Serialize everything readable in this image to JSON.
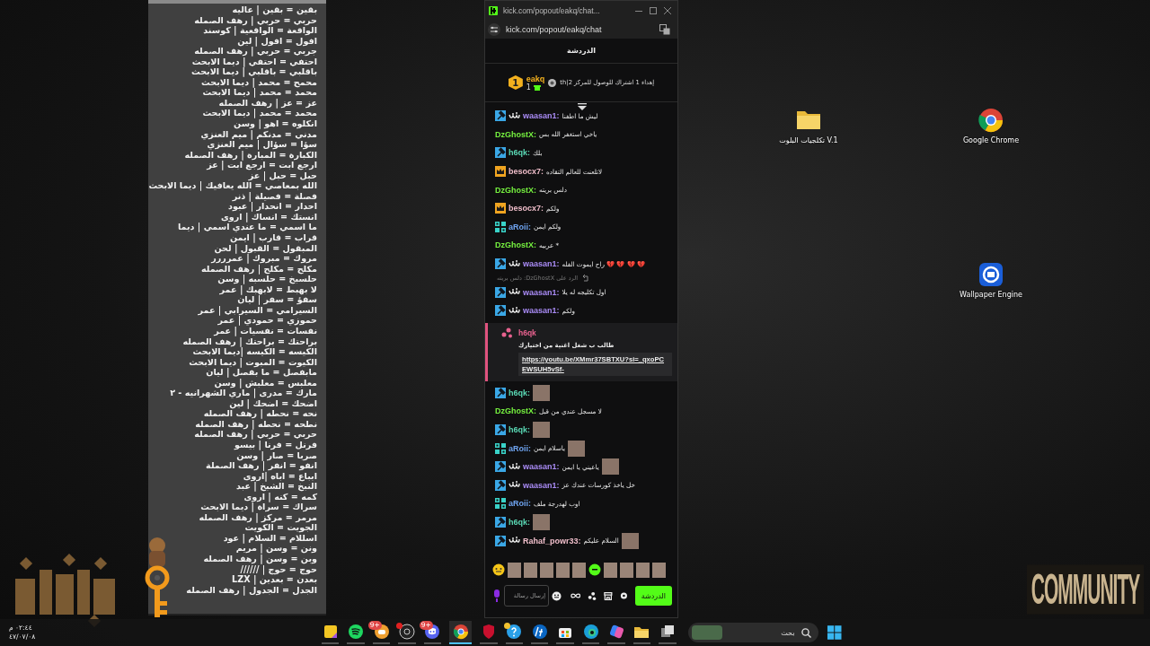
{
  "notepad": {
    "lines": [
      "بقين = بقين | عاليه",
      "حربي = حربي | رهف الصمله",
      "الواقعة = الواقعية | كوسند",
      "افول = افول | لين",
      "جربي = حربي | رهف الصمله",
      "احتفي = احتفي | ديما الابحث",
      "باقلبي = باقلبي | ديما الابحث",
      "محمح = محمد | ديما الابحث",
      "محمد = محمد | ديما الابحث",
      "عز = عز | رهف الصمله",
      "محمد = محمد | ديما الابحث",
      "انكلوه = اهو | وسن",
      "مدني = مدنكم | ميم العنزي",
      "سؤا = سؤال | ميم العنزي",
      "الكبارة = المبارة | رهف الصمله",
      "ارجع ابت = ارجع ابت | عز",
      "حبل = حبل | عز",
      "الله بمعاصي = الله يعافيك | ديما الابحث",
      "فصلة = فصيلة | ذنر",
      "احدار = انحدار | عبود",
      "انستك = انساك | اروى",
      "ما اسمي = ما عندي اسمي | ديما",
      "قراب = قارب | ايمن",
      "المبقول = القبول | لحن",
      "مروك = مبروك | عمرررر",
      "مكلح = مكلح | رهف الصمله",
      "حلسبخ = حلسبه | وسن",
      "لا بهبط = لابهبك | عمر",
      "سفؤ = سفر | ليان",
      "السيرامي = السيرابي | عمر",
      "حموزي = حمودي | عمر",
      "نفسات = نفسيات | عمر",
      "براحتك = براحتك | رهف الصمله",
      "الكيسه = الكيسه |ديما الابحث",
      "الكيوت = المبوت | ديما الابحث",
      "مابفصل = ما بفصل | ليان",
      "معلبس = معلبش | وسن",
      "مارك = مدرى | ماري الشهرانيه - ٢",
      "اضحك = اضحك | لين",
      "نحه = نحطه | رهف الصمله",
      "نطحه = نحطه | رهف الصمله",
      "حربي = حربي | رهف الصمله",
      "فرنل = فرنا | بيسو",
      "صربا = صار | وسن",
      "انفو = انفر | رهف الصملة",
      "ابباع = اباه |اروى",
      "النبخ = الشبخ | عبد",
      "كمه = كنه | اروى",
      "سراك = سراة | ديما الابحث",
      "مرمر = مركز | رهف الصمله",
      "الجويت = الكويت",
      "اسللام = السلام | عود",
      "ونن = وسن | مريم",
      "وبن = وسن | رهف الصمله",
      "حوج = حوج | //////",
      "بعدن = بعدين | LZX",
      "الجدل = الجدول | رهف الصمله"
    ]
  },
  "chat_window": {
    "title": "kick.com/popout/eakq/chat...",
    "url": "kick.com/popout/eakq/chat",
    "header": "الدردشة",
    "pinned": {
      "rank": "1",
      "username": "eakq",
      "gifts": "1",
      "text": "th|إهداء 1 اشتراك للوصول للمركز 2"
    },
    "messages": [
      {
        "kind": "message",
        "badges": [
          {
            "kind": "moderator"
          },
          {
            "kind": "subscriber"
          }
        ],
        "username": "waasan1:",
        "color": "#a98bf5",
        "text": "ليش ما اطفنا"
      },
      {
        "kind": "message",
        "username": "DzGhostX:",
        "color": "#75f03f",
        "text": "ياخي استغفر الله بس"
      },
      {
        "kind": "message",
        "badges": [
          {
            "kind": "moderator"
          }
        ],
        "username": "h6qk:",
        "color": "#5ad8b4",
        "text": "بلك"
      },
      {
        "kind": "message",
        "badges": [
          {
            "kind": "crown"
          }
        ],
        "username": "besocx7:",
        "color": "#f1bfcb",
        "text": "لاتلعنت للعالم التقاده"
      },
      {
        "kind": "message",
        "username": "DzGhostX:",
        "color": "#75f03f",
        "text": "دلس بريته"
      },
      {
        "kind": "message",
        "badges": [
          {
            "kind": "crown"
          }
        ],
        "username": "besocx7:",
        "color": "#f1bfcb",
        "text": "ولكم"
      },
      {
        "kind": "message",
        "badges": [
          {
            "kind": "og"
          }
        ],
        "username": "aRoii:",
        "color": "#6fa4f0",
        "text": "ولكم ايمن"
      },
      {
        "kind": "message",
        "username": "DzGhostX:",
        "color": "#75f03f",
        "text": "* عربيه"
      },
      {
        "kind": "message",
        "badges": [
          {
            "kind": "moderator"
          },
          {
            "kind": "subscriber"
          }
        ],
        "username": "waasan1:",
        "color": "#a98bf5",
        "text": "💔 💔 💔 💔 راح ايموت الفله"
      },
      {
        "kind": "message",
        "badges": [
          {
            "kind": "moderator"
          },
          {
            "kind": "subscriber"
          }
        ],
        "username": "waasan1:",
        "color": "#a98bf5",
        "text": "اول تكليجه له يلا",
        "reply_to": "الرد على DzGhostX: دلس بريته"
      },
      {
        "kind": "message",
        "badges": [
          {
            "kind": "moderator"
          },
          {
            "kind": "subscriber"
          }
        ],
        "username": "waasan1:",
        "color": "#a98bf5",
        "text": "ولكم"
      },
      {
        "kind": "highlight",
        "username": "h6qk",
        "color": "#e8628f",
        "text": "طالب ب شغل اغنية من اختيارك",
        "link": "https://youtu.be/XMmr37SBTXU?si=_qxoPCEWSUH5vSf-"
      },
      {
        "kind": "message",
        "badges": [
          {
            "kind": "moderator"
          }
        ],
        "username": "h6qk:",
        "color": "#5ad8b4",
        "emote": true
      },
      {
        "kind": "message",
        "username": "DzGhostX:",
        "color": "#75f03f",
        "text": "لا مسجل عندي من قبل"
      },
      {
        "kind": "message",
        "badges": [
          {
            "kind": "moderator"
          }
        ],
        "username": "h6qk:",
        "color": "#5ad8b4",
        "emote": true
      },
      {
        "kind": "message",
        "badges": [
          {
            "kind": "og"
          }
        ],
        "username": "aRoii:",
        "color": "#6fa4f0",
        "text": "ياسلام ايمن",
        "emote": true
      },
      {
        "kind": "message",
        "badges": [
          {
            "kind": "moderator"
          },
          {
            "kind": "subscriber"
          }
        ],
        "username": "waasan1:",
        "color": "#a98bf5",
        "text": "ياعيني يا ايمن",
        "emote": true
      },
      {
        "kind": "message",
        "badges": [
          {
            "kind": "moderator"
          },
          {
            "kind": "subscriber"
          }
        ],
        "username": "waasan1:",
        "color": "#a98bf5",
        "text": "خل ياخذ كورسات عندك عز"
      },
      {
        "kind": "message",
        "badges": [
          {
            "kind": "og"
          }
        ],
        "username": "aRoii:",
        "color": "#6fa4f0",
        "text": "اوب لهدرجة ملف"
      },
      {
        "kind": "message",
        "badges": [
          {
            "kind": "moderator"
          }
        ],
        "username": "h6qk:",
        "color": "#5ad8b4",
        "emote": true
      },
      {
        "kind": "message",
        "badges": [
          {
            "kind": "moderator"
          },
          {
            "kind": "subscriber"
          }
        ],
        "username": "Rahaf_powr33:",
        "color": "#f1bfcb",
        "text": "السلام عليكم",
        "emote": true
      }
    ],
    "input": {
      "placeholder": "إرسال رسالة"
    },
    "send_button": "الدردشة"
  },
  "desktop_icons": [
    {
      "kind": "chrome",
      "label": "Google Chrome"
    },
    {
      "kind": "folder",
      "label": "تكلجيات البلوت V.1"
    },
    {
      "kind": "wallpaper",
      "label": "Wallpaper Engine"
    }
  ],
  "overlay": {
    "community": "COMMUNITY"
  },
  "taskbar": {
    "search_placeholder": "بحث",
    "apps": [
      {
        "kind": "taskview",
        "active": false
      },
      {
        "kind": "files",
        "active": false
      },
      {
        "kind": "copilot",
        "active": false
      },
      {
        "kind": "edge",
        "active": false
      },
      {
        "kind": "store",
        "active": false
      },
      {
        "kind": "hp",
        "active": false
      },
      {
        "kind": "help",
        "color": "#f2c230",
        "active": false
      },
      {
        "kind": "shield",
        "active": false
      },
      {
        "kind": "chrome",
        "active": true
      },
      {
        "kind": "discord",
        "badge": "9+",
        "active": false
      },
      {
        "kind": "obs",
        "color": "#e02020",
        "active": false
      },
      {
        "kind": "chat",
        "badge": "9+",
        "active": false
      },
      {
        "kind": "spotify",
        "active": false
      },
      {
        "kind": "notes",
        "active": false
      }
    ],
    "time": "٠٢:٤٤ م",
    "date": "٤٧/٠٧/٠٨"
  }
}
